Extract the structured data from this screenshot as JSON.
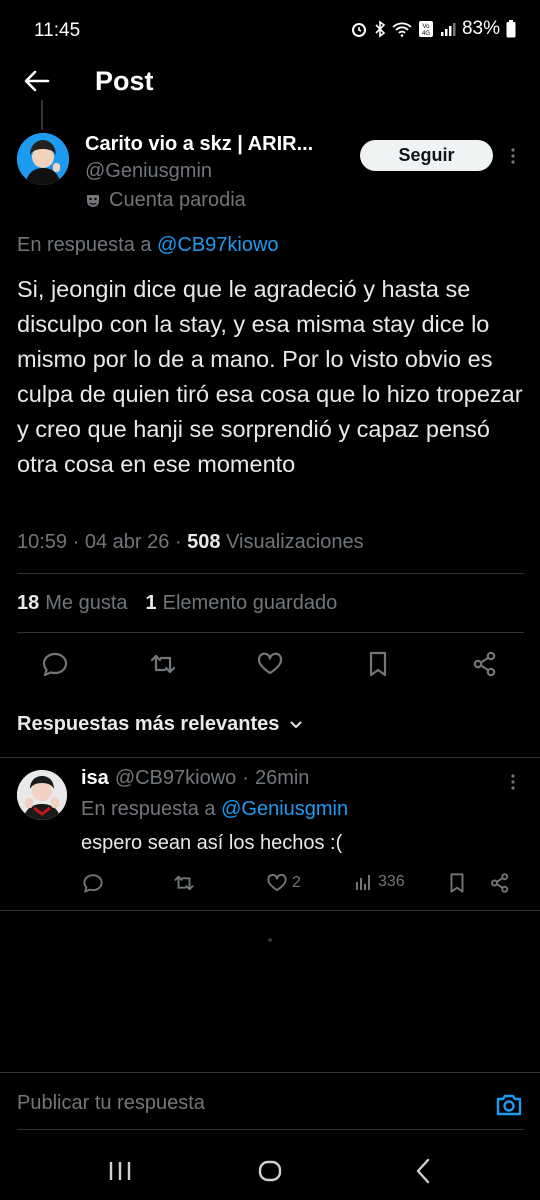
{
  "status_bar": {
    "time": "11:45",
    "battery": "83%",
    "icons": [
      "alarm-icon",
      "bluetooth-icon",
      "wifi-icon",
      "volte-icon",
      "signal-icon",
      "battery-icon"
    ]
  },
  "header": {
    "title": "Post"
  },
  "post": {
    "author_name": "Carito vio a skz | ARIR...",
    "author_handle": "@Geniusgmin",
    "parody_label": "Cuenta parodia",
    "follow_label": "Seguir",
    "reply_prefix": "En respuesta a",
    "reply_handle": "@CB97kiowo",
    "text": "Si, jeongin dice que le agradeció y hasta se disculpo con la stay, y esa misma stay dice lo mismo por lo de a mano. Por lo visto obvio es culpa de quien tiró esa cosa que lo hizo tropezar y creo que hanji se sorprendió y capaz pensó otra cosa en ese momento",
    "time": "10:59",
    "date": "04 abr 26",
    "views_count": "508",
    "views_label": "Visualizaciones",
    "likes_count": "18",
    "likes_label": "Me gusta",
    "saved_count": "1",
    "saved_label": "Elemento guardado"
  },
  "replies_section": {
    "label": "Respuestas más relevantes"
  },
  "reply": {
    "name": "isa",
    "handle": "@CB97kiowo",
    "separator": "·",
    "time": "26min",
    "reply_prefix": "En respuesta a",
    "reply_handle": "@Geniusgmin",
    "text": "espero sean así los hechos :(",
    "likes": "2",
    "views": "336"
  },
  "compose": {
    "placeholder": "Publicar tu respuesta"
  },
  "colors": {
    "background": "#000000",
    "accent": "#1d9bf0",
    "muted": "#71767b",
    "text": "#e7e9ea"
  }
}
